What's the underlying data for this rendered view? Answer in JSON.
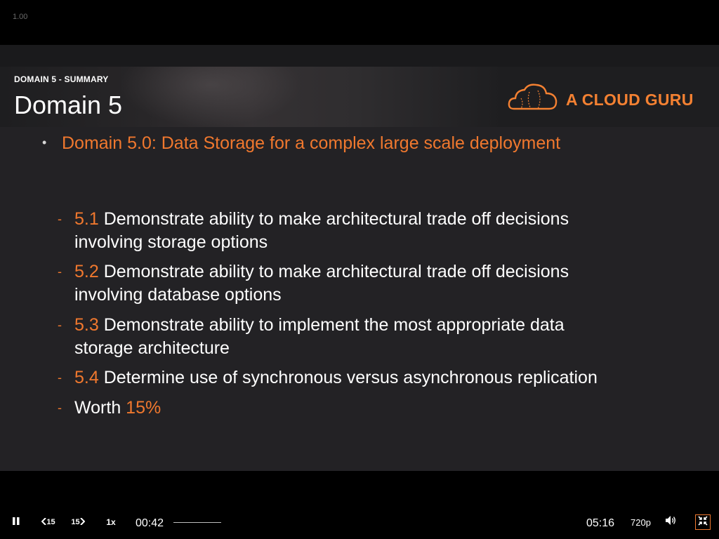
{
  "corner_label": "1.00",
  "slide": {
    "section_label": "DOMAIN 5 - SUMMARY",
    "title": "Domain 5",
    "brand_text": "A CLOUD GURU",
    "main_bullet": "Domain 5.0: Data Storage for a complex large scale deployment",
    "sub_items": [
      {
        "num": "5.1",
        "line1": " Demonstrate ability to make architectural trade off decisions",
        "line2": "involving storage options"
      },
      {
        "num": "5.2",
        "line1": " Demonstrate ability to make architectural trade off decisions",
        "line2": "involving database options"
      },
      {
        "num": "5.3",
        "line1": " Demonstrate ability to implement the most appropriate data",
        "line2": "storage architecture"
      },
      {
        "num": "5.4",
        "line1": " Determine use of synchronous versus asynchronous replication",
        "line2": ""
      }
    ],
    "worth_label": "Worth ",
    "worth_value": "15%"
  },
  "controls": {
    "pause_icon": "pause-icon",
    "rewind_label": "15",
    "forward_label": "15",
    "speed_label": "1x",
    "current_time": "00:42",
    "duration": "05:16",
    "quality_label": "720p",
    "volume_icon": "volume-icon",
    "exit_fullscreen_icon": "exit-fullscreen-icon",
    "progress_fraction": 0.134
  },
  "colors": {
    "accent": "#f0782e",
    "brand": "#f48132",
    "slide_bg": "#232225",
    "player_bg": "#000000"
  }
}
